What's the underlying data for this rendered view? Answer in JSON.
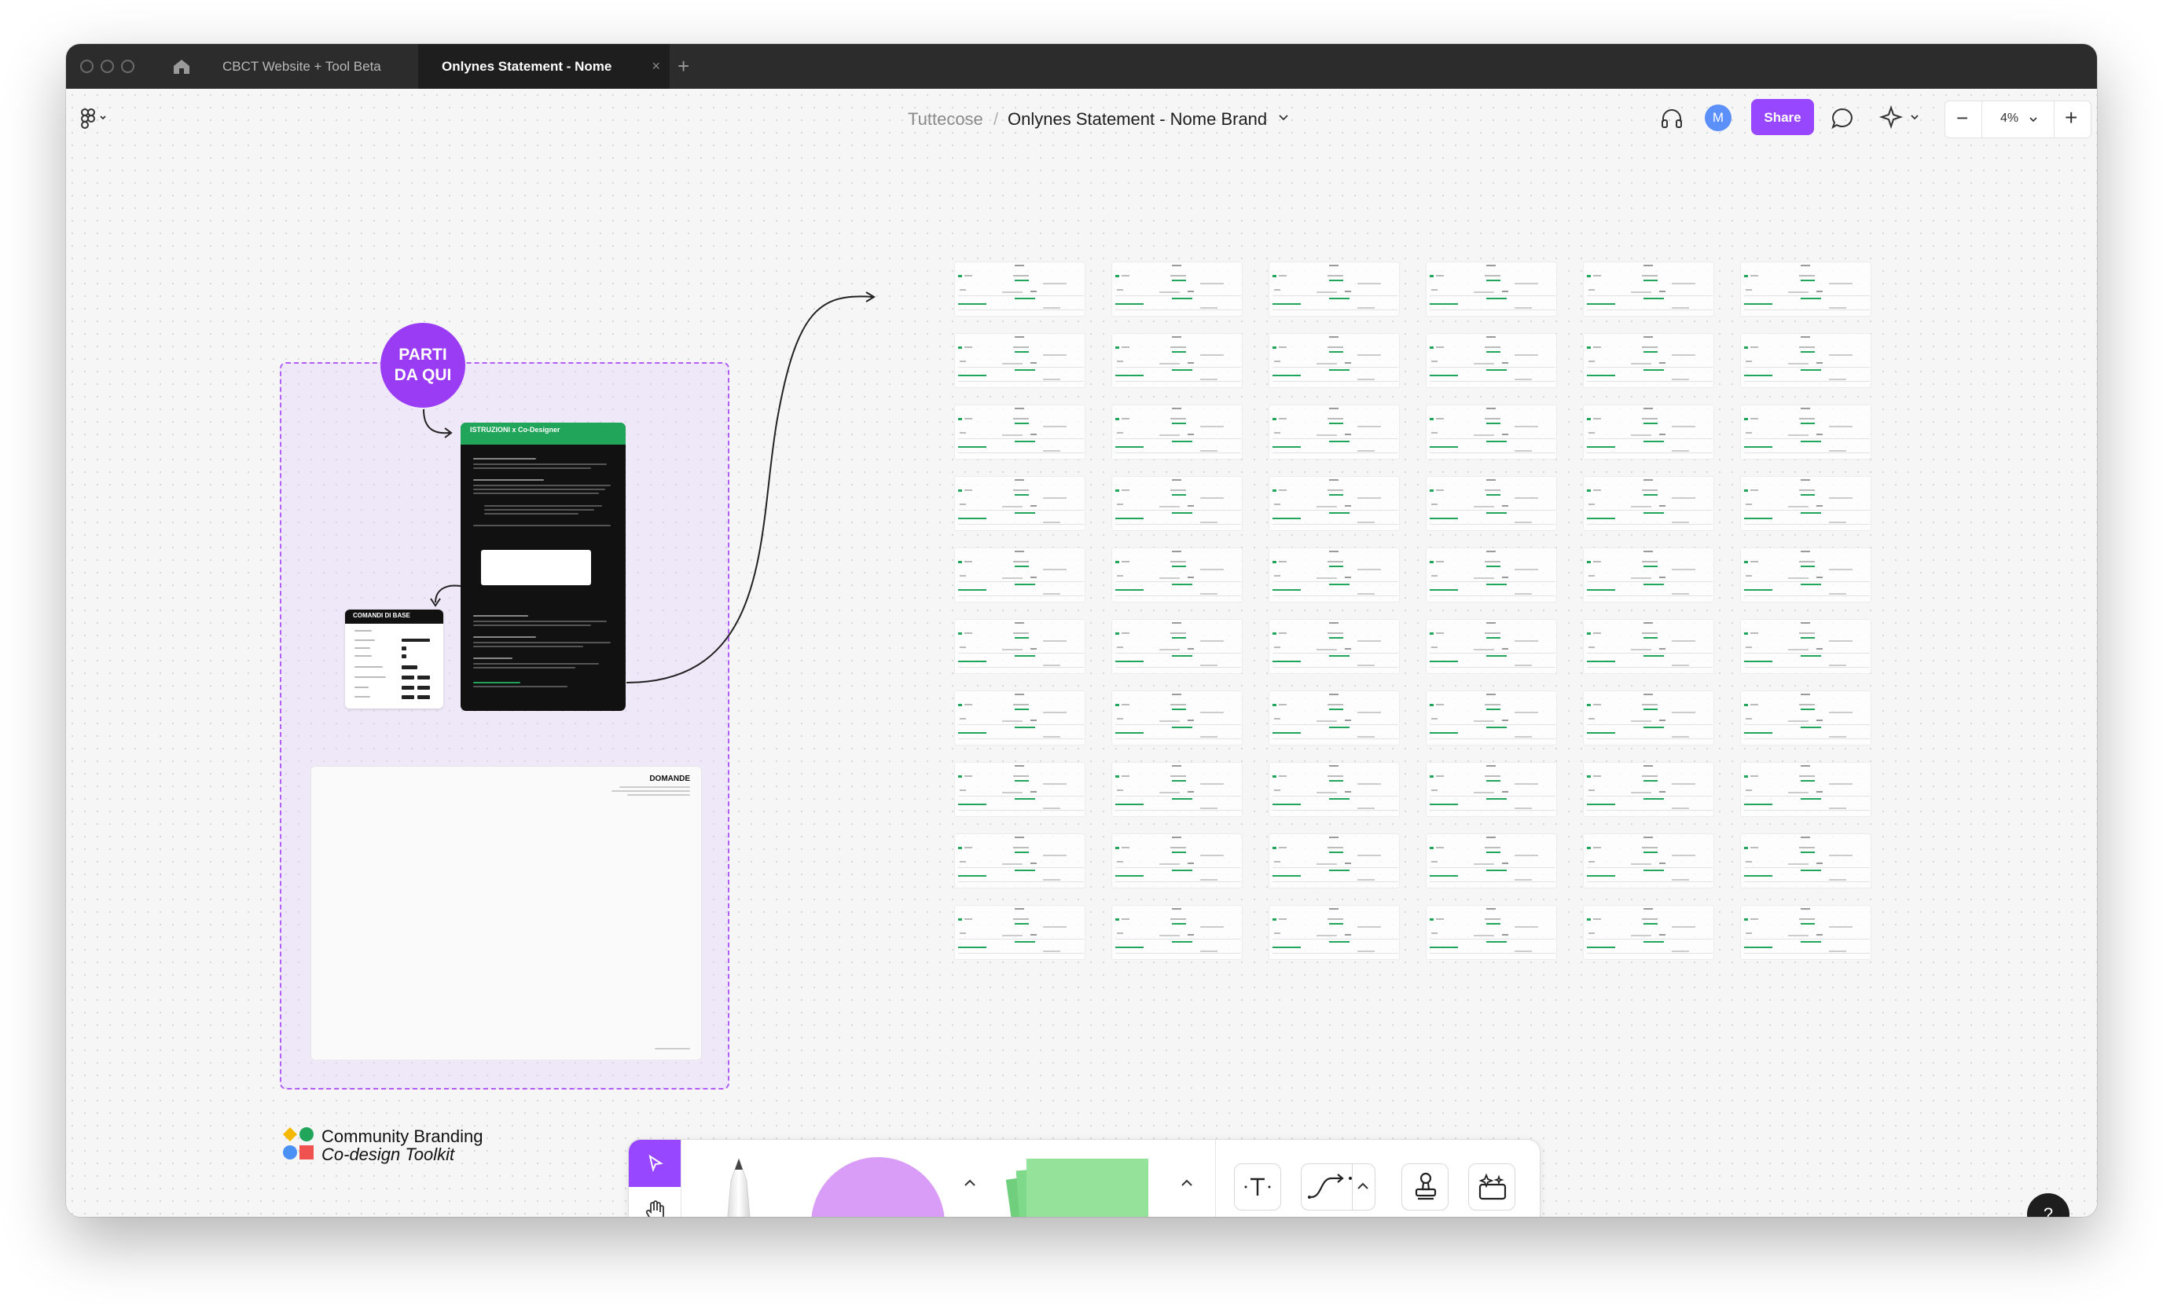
{
  "browser": {
    "tabs": [
      {
        "label": "CBCT Website + Tool Beta",
        "active": false
      },
      {
        "label": "Onlynes Statement - Nome Brand",
        "active": true
      }
    ],
    "new_tab_icon": "plus-icon",
    "home_icon": "home-icon"
  },
  "topbar": {
    "breadcrumb_parent": "Tuttecose",
    "breadcrumb_sep": "/",
    "file_name": "Onlynes Statement - Nome Brand",
    "avatar_initial": "M",
    "share_label": "Share",
    "zoom_label": "4%",
    "zoom_minus": "−",
    "zoom_plus": "+",
    "icons": [
      "figma-menu-icon",
      "headphones-icon",
      "comment-icon",
      "ai-sparkle-icon"
    ]
  },
  "canvas": {
    "start_badge": {
      "line1": "PARTI",
      "line2": "DA QUI"
    },
    "instructions_card": {
      "title": "ISTRUZIONI x Co-Designer"
    },
    "commands_card": {
      "title": "COMANDI DI BASE"
    },
    "questions_card": {
      "title": "DOMANDE"
    },
    "brand": {
      "line1": "Community Branding",
      "line2": "Co-design Toolkit"
    },
    "mini_grid": {
      "rows": 10,
      "cols": 6
    },
    "accent_colors": {
      "purple": "#9747ff",
      "green": "#21a55a",
      "section_border": "#b15cf5"
    }
  },
  "toolbar": {
    "tools": [
      "select-cursor-icon",
      "hand-icon",
      "pen-tool",
      "shape-circle",
      "sticky-note",
      "text-tool-icon",
      "connector-icon",
      "stamp-icon",
      "widget-icon"
    ]
  },
  "help": {
    "label": "?"
  }
}
